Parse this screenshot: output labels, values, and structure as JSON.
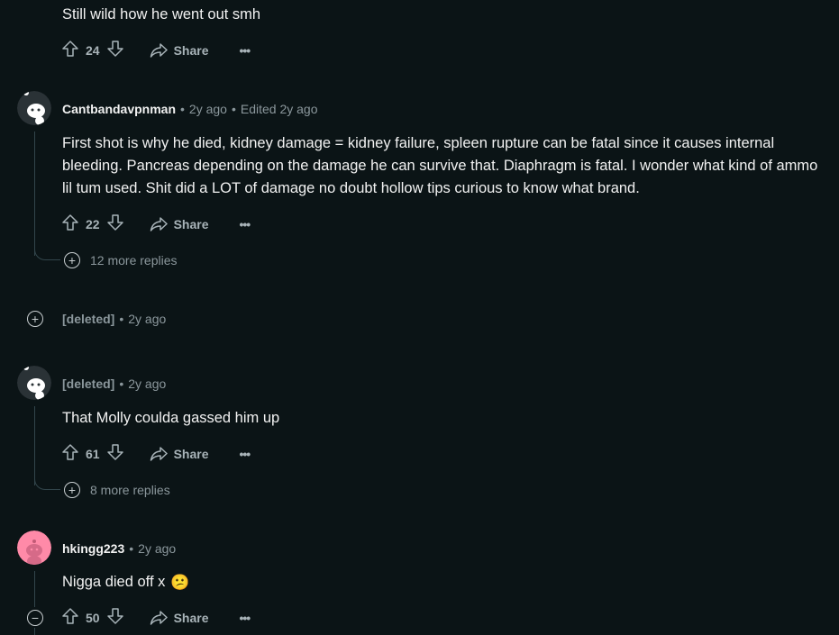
{
  "comments": [
    {
      "text": "Still wild how he went out smh",
      "votes": "24",
      "share_label": "Share"
    },
    {
      "username": "Cantbandavpnman",
      "time": "2y ago",
      "edited": "Edited 2y ago",
      "text": "First shot is why he died, kidney damage = kidney failure, spleen rupture can be fatal since it causes internal bleeding. Pancreas depending on the damage he can survive that. Diaphragm is fatal. I wonder what kind of ammo lil tum used. Shit did a LOT of damage no doubt hollow tips curious to know what brand.",
      "votes": "22",
      "share_label": "Share",
      "more_replies": "12 more replies"
    },
    {
      "username": "[deleted]",
      "time": "2y ago"
    },
    {
      "username": "[deleted]",
      "time": "2y ago",
      "text": "That Molly coulda gassed him up",
      "votes": "61",
      "share_label": "Share",
      "more_replies": "8 more replies"
    },
    {
      "username": "hkingg223",
      "time": "2y ago",
      "text": "Nigga died off x",
      "emoji": "😕",
      "votes": "50",
      "share_label": "Share"
    }
  ],
  "separator": "•",
  "more_icon": "•••",
  "icons": {
    "upvote": "upvote-arrow-icon",
    "downvote": "downvote-arrow-icon",
    "share": "share-arrow-icon",
    "avatar": "snoo-avatar",
    "expand": "plus-circle-icon",
    "collapse": "minus-circle-icon"
  },
  "colors": {
    "background": "#0b1416",
    "text": "#f2f2f2",
    "meta": "#8b979c",
    "thread_line": "#33464c",
    "pink_avatar": "#ff8aa8"
  }
}
